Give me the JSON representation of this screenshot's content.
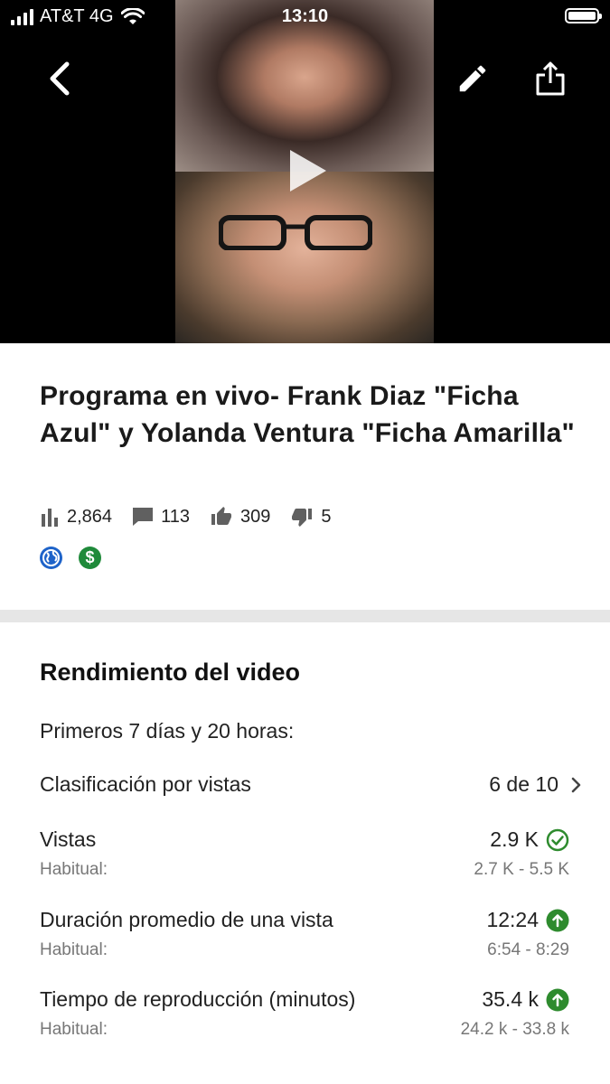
{
  "status_bar": {
    "carrier": "AT&T 4G",
    "time": "13:10"
  },
  "header": {
    "icons": [
      "back-arrow-icon",
      "pencil-icon",
      "share-icon"
    ]
  },
  "video": {
    "title": "Programa en vivo- Frank Diaz \"Ficha Azul\" y Yolanda Ventura \"Ficha Amarilla\"",
    "stats": {
      "views": "2,864",
      "comments": "113",
      "likes": "309",
      "dislikes": "5"
    },
    "badges": [
      "globe-icon",
      "dollar-icon"
    ],
    "colors": {
      "globe": "#1e63c9",
      "money": "#1f8a3a"
    }
  },
  "performance": {
    "title": "Rendimiento del video",
    "period": "Primeros 7 días y 20 horas:",
    "ranking": {
      "label": "Clasificación por vistas",
      "value": "6 de 10"
    },
    "metrics": [
      {
        "label": "Vistas",
        "sub_label": "Habitual:",
        "value": "2.9 K",
        "range": "2.7 K - 5.5 K",
        "status_icon": "check-circle-icon"
      },
      {
        "label": "Duración promedio de una vista",
        "sub_label": "Habitual:",
        "value": "12:24",
        "range": "6:54 - 8:29",
        "status_icon": "arrow-up-circle-icon"
      },
      {
        "label": "Tiempo de reproducción (minutos)",
        "sub_label": "Habitual:",
        "value": "35.4 k",
        "range": "24.2 k - 33.8 k",
        "status_icon": "arrow-up-circle-icon"
      }
    ],
    "status_color": "#2e8b2e"
  }
}
